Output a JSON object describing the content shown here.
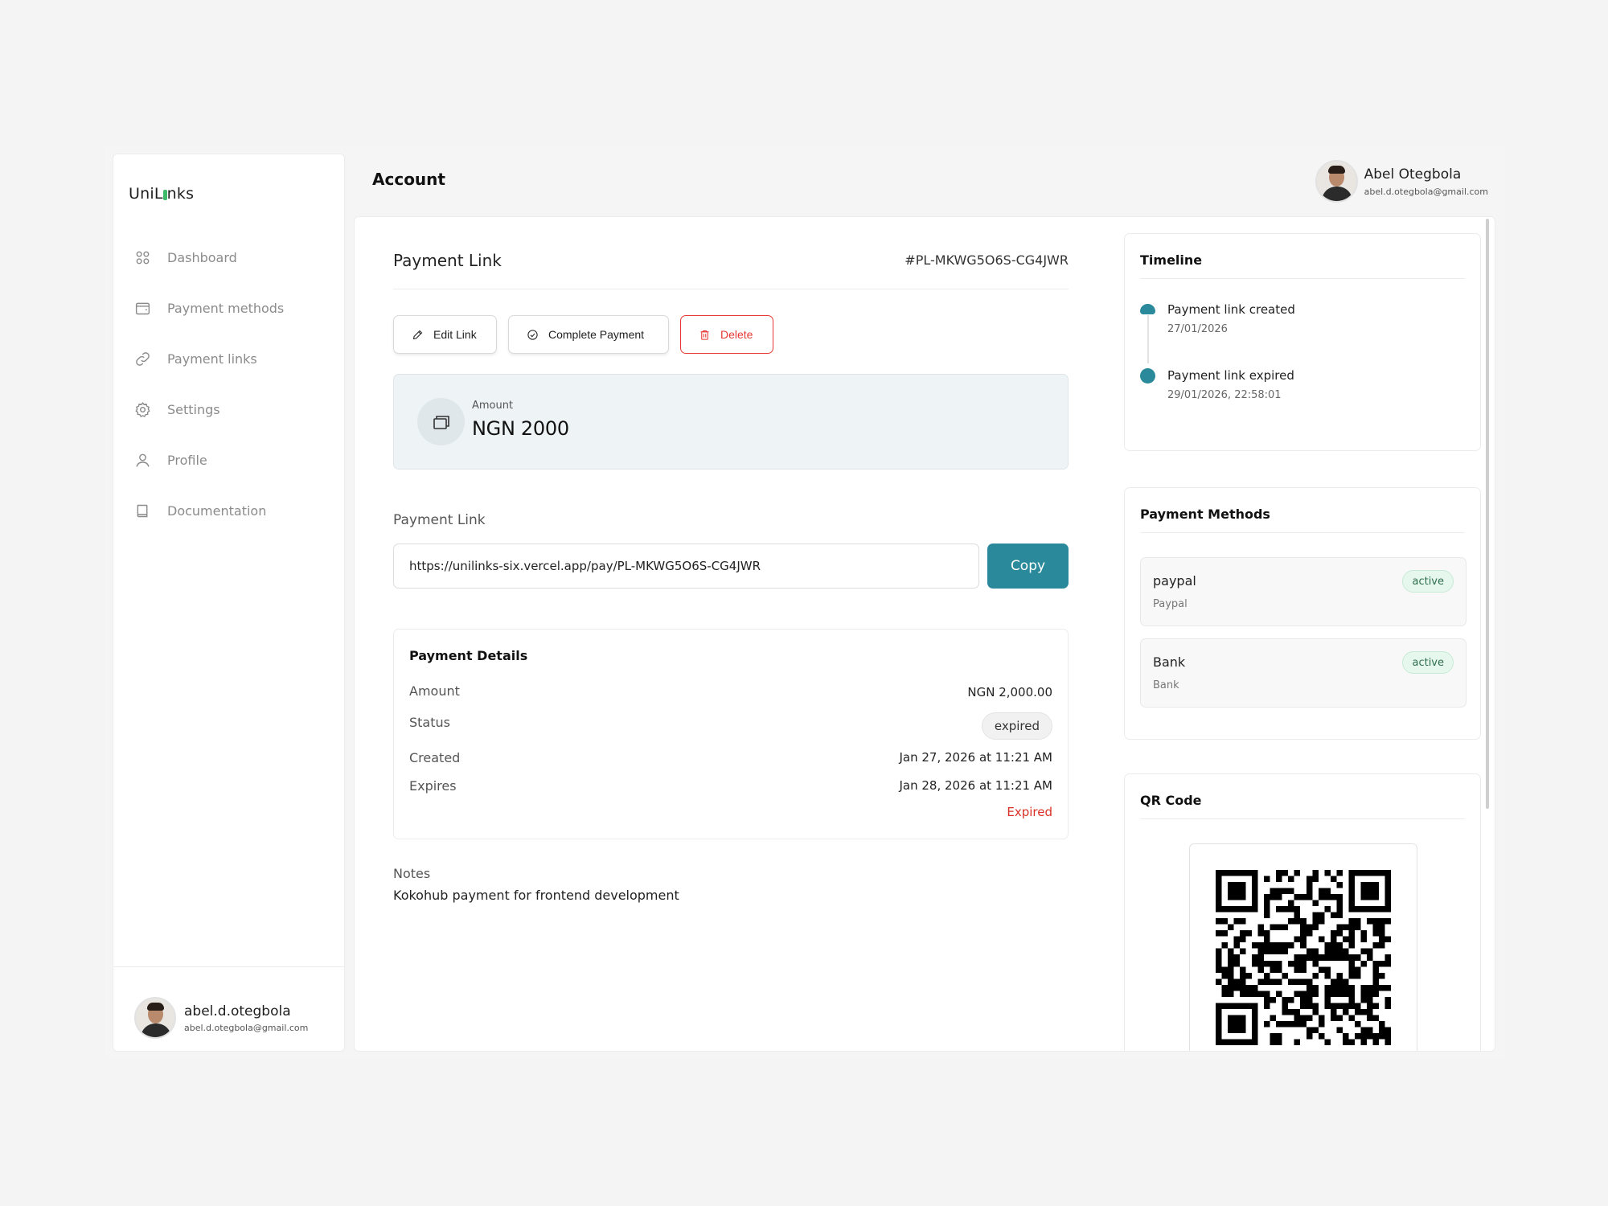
{
  "app": {
    "logo_prefix": "UniL",
    "logo_suffix": "nks"
  },
  "sidebar": {
    "items": [
      {
        "label": "Dashboard",
        "icon": "grid-icon"
      },
      {
        "label": "Payment methods",
        "icon": "wallet-icon"
      },
      {
        "label": "Payment links",
        "icon": "link-icon"
      },
      {
        "label": "Settings",
        "icon": "gear-icon"
      },
      {
        "label": "Profile",
        "icon": "user-icon"
      },
      {
        "label": "Documentation",
        "icon": "book-icon"
      }
    ],
    "user": {
      "name": "abel.d.otegbola",
      "email": "abel.d.otegbola@gmail.com"
    }
  },
  "header": {
    "title": "Account",
    "user": {
      "name": "Abel Otegbola",
      "email": "abel.d.otegbola@gmail.com"
    }
  },
  "payment_link": {
    "title": "Payment Link",
    "id": "#PL-MKWG5O6S-CG4JWR",
    "actions": {
      "edit": "Edit Link",
      "complete": "Complete Payment",
      "delete": "Delete"
    },
    "amount": {
      "label": "Amount",
      "value": "NGN 2000"
    },
    "link": {
      "label": "Payment Link",
      "url": "https://unilinks-six.vercel.app/pay/PL-MKWG5O6S-CG4JWR",
      "copy_label": "Copy"
    },
    "details": {
      "title": "Payment Details",
      "amount_label": "Amount",
      "amount_value": "NGN 2,000.00",
      "status_label": "Status",
      "status_value": "expired",
      "created_label": "Created",
      "created_value": "Jan 27, 2026 at 11:21 AM",
      "expires_label": "Expires",
      "expires_value": "Jan 28, 2026 at 11:21 AM",
      "expired_note": "Expired"
    },
    "notes": {
      "label": "Notes",
      "value": "Kokohub payment for frontend development"
    }
  },
  "timeline": {
    "title": "Timeline",
    "events": [
      {
        "title": "Payment link created",
        "date": "27/01/2026"
      },
      {
        "title": "Payment link expired",
        "date": "29/01/2026, 22:58:01"
      }
    ]
  },
  "payment_methods": {
    "title": "Payment Methods",
    "items": [
      {
        "name": "paypal",
        "type": "Paypal",
        "status": "active"
      },
      {
        "name": "Bank",
        "type": "Bank",
        "status": "active"
      }
    ]
  },
  "qr": {
    "title": "QR Code"
  },
  "colors": {
    "accent": "#2a8a9b",
    "danger": "#e53935",
    "active_badge": "#e6f7ee"
  }
}
